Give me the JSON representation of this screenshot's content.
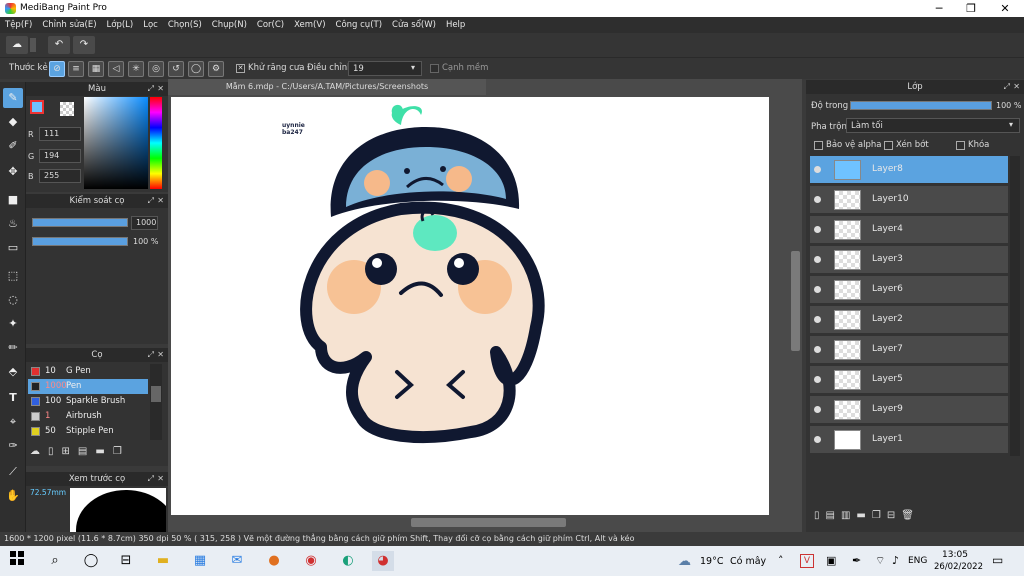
{
  "window": {
    "title": "MediBang Paint Pro",
    "minimize": "─",
    "maximize": "❐",
    "close": "✕"
  },
  "menu": [
    "Tệp(F)",
    "Chỉnh sửa(E)",
    "Lớp(L)",
    "Lọc",
    "Chọn(S)",
    "Chụp(N)",
    "Cor(C)",
    "Xem(V)",
    "Công cụ(T)",
    "Cửa sổ(W)",
    "Help"
  ],
  "toolbar2": {
    "ruler_label": "Thước kẻ",
    "antialias_label": "Khử răng cưa",
    "adjust_label": "Điều chỉnh",
    "adjust_value": "19",
    "smooth_label": "Cạnh mềm"
  },
  "color_panel": {
    "title": "Màu",
    "r_label": "R",
    "g_label": "G",
    "b_label": "B",
    "r": "111",
    "g": "194",
    "b": "255",
    "fg_color": "#6fc2ff"
  },
  "brush_control": {
    "title": "Kiểm soát cọ",
    "size": "1000",
    "opacity": "100 %"
  },
  "brush_panel": {
    "title": "Cọ",
    "items": [
      {
        "size": "10",
        "name": "G Pen",
        "color": "#e03030"
      },
      {
        "size": "1000",
        "name": "Pen",
        "color": "#222222"
      },
      {
        "size": "100",
        "name": "Sparkle Brush",
        "color": "#3060e0"
      },
      {
        "size": "1",
        "name": "Airbrush",
        "color": "#cccccc"
      },
      {
        "size": "50",
        "name": "Stipple Pen",
        "color": "#e0d020"
      }
    ]
  },
  "preview_panel": {
    "title": "Xem trước cọ",
    "size": "72.57mm"
  },
  "document": {
    "tab": "Mẫm 6.mdp - C:/Users/A.TAM/Pictures/Screenshots",
    "signature": "uynnie\nba247"
  },
  "layers_panel": {
    "title": "Lớp",
    "opacity_label": "Độ trong",
    "opacity_value": "100 %",
    "blend_label": "Pha trộn",
    "blend_value": "Làm tối",
    "protect_alpha": "Bảo vệ alpha",
    "clip": "Xén bớt",
    "lock": "Khóa",
    "layers": [
      "Layer8",
      "Layer10",
      "Layer4",
      "Layer3",
      "Layer6",
      "Layer2",
      "Layer7",
      "Layer5",
      "Layer9",
      "Layer1"
    ],
    "selected": "Layer8"
  },
  "status": {
    "size": "1600 * 1200 pixel",
    "cm": "(11.6 * 8.7cm)",
    "dpi": "350 dpi",
    "zoom": "50 %",
    "coords": "( 315, 258 )",
    "hint": "Vẽ một đường thẳng bằng cách giữ phím Shift, Thay đổi cỡ cọ bằng cách giữ phím Ctrl, Alt và kéo"
  },
  "taskbar": {
    "weather": "19°C",
    "weather_text": "Có mây",
    "lang": "ENG",
    "time": "13:05",
    "date": "26/02/2022"
  }
}
